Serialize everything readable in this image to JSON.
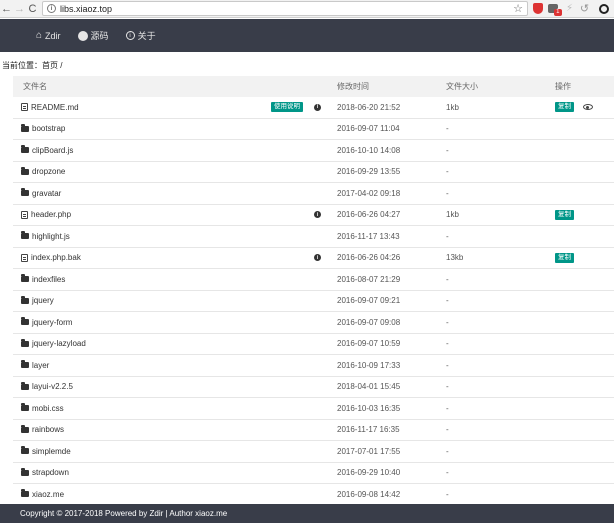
{
  "browser": {
    "url": "libs.xiaoz.top",
    "extension_badge": "1"
  },
  "navbar": {
    "items": [
      {
        "label": "Zdir",
        "icon": "home-icon"
      },
      {
        "label": "源码",
        "icon": "github-icon"
      },
      {
        "label": "关于",
        "icon": "info-icon"
      }
    ]
  },
  "breadcrumb": "当前位置：首页 /",
  "table": {
    "headers": {
      "name": "文件名",
      "time": "修改时间",
      "size": "文件大小",
      "op": "操作"
    },
    "readme_label": "使用说明",
    "copy_label": "复制",
    "rows": [
      {
        "name": "README.md",
        "type": "file",
        "time": "2018-06-20 21:52",
        "size": "1kb"
      },
      {
        "name": "bootstrap",
        "type": "folder",
        "time": "2016-09-07 11:04",
        "size": "-"
      },
      {
        "name": "clipBoard.js",
        "type": "folder",
        "time": "2016-10-10 14:08",
        "size": "-"
      },
      {
        "name": "dropzone",
        "type": "folder",
        "time": "2016-09-29 13:55",
        "size": "-"
      },
      {
        "name": "gravatar",
        "type": "folder",
        "time": "2017-04-02 09:18",
        "size": "-"
      },
      {
        "name": "header.php",
        "type": "file",
        "time": "2016-06-26 04:27",
        "size": "1kb"
      },
      {
        "name": "highlight.js",
        "type": "folder",
        "time": "2016-11-17 13:43",
        "size": "-"
      },
      {
        "name": "index.php.bak",
        "type": "file",
        "time": "2016-06-26 04:26",
        "size": "13kb"
      },
      {
        "name": "indexfiles",
        "type": "folder",
        "time": "2016-08-07 21:29",
        "size": "-"
      },
      {
        "name": "jquery",
        "type": "folder",
        "time": "2016-09-07 09:21",
        "size": "-"
      },
      {
        "name": "jquery-form",
        "type": "folder",
        "time": "2016-09-07 09:08",
        "size": "-"
      },
      {
        "name": "jquery-lazyload",
        "type": "folder",
        "time": "2016-09-07 10:59",
        "size": "-"
      },
      {
        "name": "layer",
        "type": "folder",
        "time": "2016-10-09 17:33",
        "size": "-"
      },
      {
        "name": "layui-v2.2.5",
        "type": "folder",
        "time": "2018-04-01 15:45",
        "size": "-"
      },
      {
        "name": "mobi.css",
        "type": "folder",
        "time": "2016-10-03 16:35",
        "size": "-"
      },
      {
        "name": "rainbows",
        "type": "folder",
        "time": "2016-11-17 16:35",
        "size": "-"
      },
      {
        "name": "simplemde",
        "type": "folder",
        "time": "2017-07-01 17:55",
        "size": "-"
      },
      {
        "name": "strapdown",
        "type": "folder",
        "time": "2016-09-29 10:40",
        "size": "-"
      },
      {
        "name": "xiaoz.me",
        "type": "folder",
        "time": "2016-09-08 14:42",
        "size": "-"
      }
    ]
  },
  "footer": "Copyright © 2017-2018 Powered by Zdir | Author xiaoz.me"
}
